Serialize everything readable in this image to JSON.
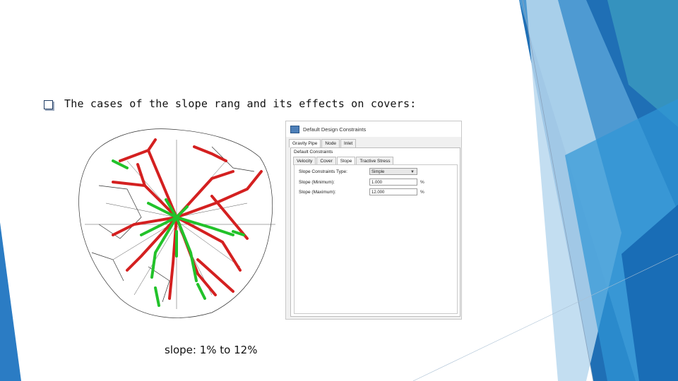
{
  "bullet": {
    "text": "The cases of the slope rang and its effects on covers:",
    "icon": "square-bullet-icon"
  },
  "dialog": {
    "title": "Default Design Constraints",
    "tabs": [
      "Gravity Pipe",
      "Node",
      "Inlet"
    ],
    "group_label": "Default Constraints",
    "subtabs": [
      "Velocity",
      "Cover",
      "Slope",
      "Tractive Stress"
    ],
    "fields": [
      {
        "label": "Slope Constraints Type:",
        "value": "Simple",
        "unit": ""
      },
      {
        "label": "Slope (Minimum):",
        "value": "1.000",
        "unit": "%"
      },
      {
        "label": "Slope (Maximum):",
        "value": "12.000",
        "unit": "%"
      }
    ]
  },
  "caption": "slope: 1% to 12%",
  "colors": {
    "accent_dark": "#1f6fb5",
    "accent_light": "#3da3d9",
    "pipe_red": "#d42020",
    "pipe_green": "#22c22a"
  }
}
